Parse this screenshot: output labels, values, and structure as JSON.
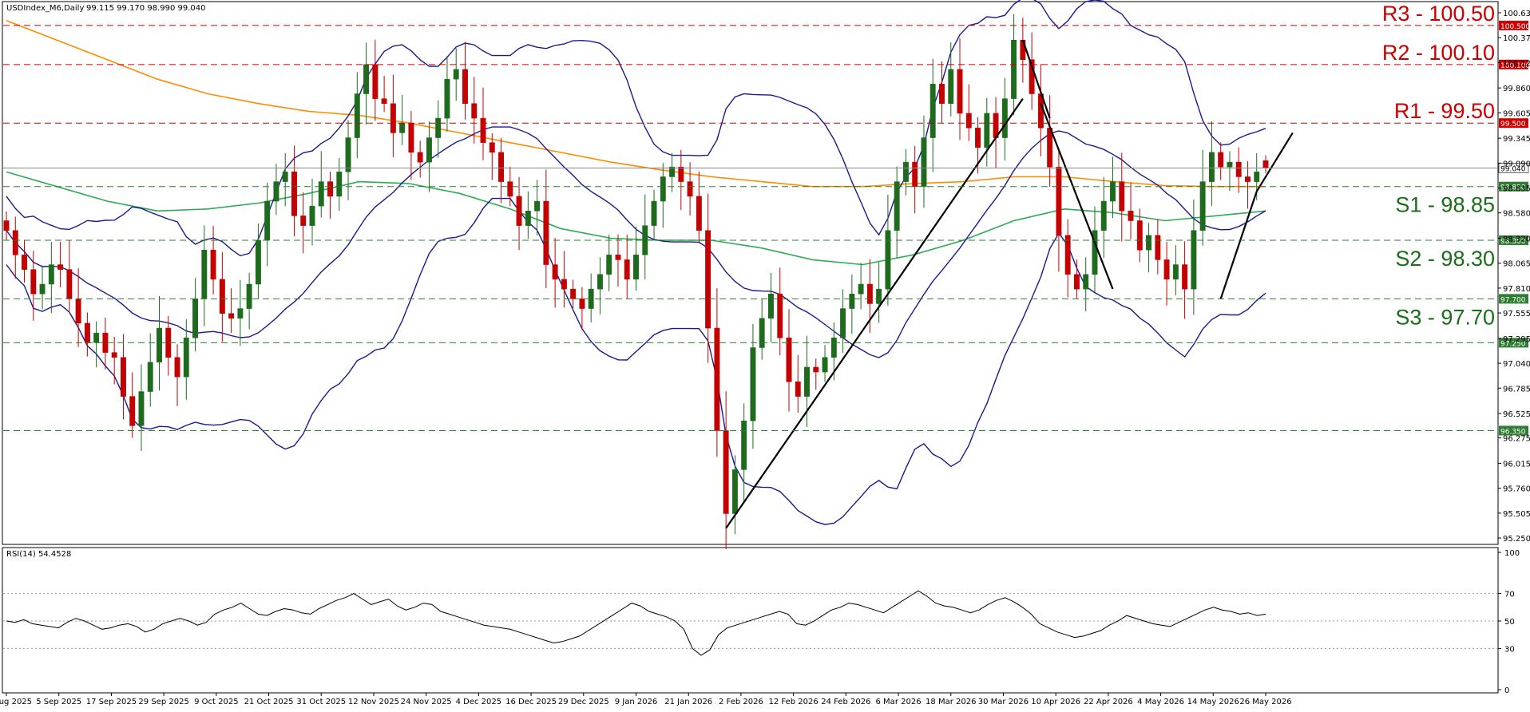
{
  "header": {
    "symbol": "USDIndex_M6,Daily",
    "ohlc": "99.115 99.170 98.990 99.040"
  },
  "rsi": {
    "label": "RSI(14) 54.4528",
    "ticks": [
      "100",
      "70",
      "50",
      "30",
      "0"
    ],
    "values": [
      50,
      49,
      51,
      48,
      47,
      46,
      45,
      49,
      52,
      50,
      47,
      44,
      45,
      47,
      48,
      46,
      42,
      44,
      48,
      50,
      52,
      50,
      47,
      49,
      55,
      58,
      60,
      63,
      59,
      55,
      54,
      57,
      59,
      58,
      56,
      55,
      59,
      62,
      65,
      67,
      70,
      66,
      62,
      64,
      66,
      61,
      58,
      60,
      63,
      62,
      57,
      55,
      53,
      51,
      49,
      47,
      46,
      45,
      44,
      42,
      40,
      38,
      36,
      34,
      35,
      37,
      39,
      43,
      47,
      51,
      55,
      59,
      63,
      61,
      57,
      55,
      53,
      50,
      44,
      30,
      25,
      29,
      40,
      45,
      47,
      49,
      51,
      53,
      55,
      57,
      55,
      48,
      47,
      50,
      54,
      58,
      60,
      63,
      62,
      60,
      58,
      56,
      60,
      64,
      68,
      72,
      68,
      63,
      61,
      60,
      58,
      56,
      58,
      62,
      65,
      67,
      64,
      60,
      55,
      48,
      45,
      42,
      40,
      38,
      39,
      41,
      43,
      47,
      50,
      54,
      52,
      50,
      48,
      47,
      46,
      49,
      52,
      55,
      58,
      60,
      58,
      57,
      55,
      56,
      54,
      55
    ],
    "colors": {
      "line": "#000000",
      "levels": "#999999"
    }
  },
  "price_axis": {
    "ticks": [
      "100.630",
      "100.375",
      "100.120",
      "99.860",
      "99.605",
      "99.345",
      "99.090",
      "98.835",
      "98.580",
      "98.320",
      "98.065",
      "97.810",
      "97.555",
      "97.295",
      "97.040",
      "96.785",
      "96.525",
      "96.275",
      "96.015",
      "95.760",
      "95.505",
      "95.250"
    ]
  },
  "level_tags": [
    "100.500",
    "100.100",
    "99.500",
    "99.040",
    "98.850",
    "98.300",
    "97.700",
    "97.250",
    "96.350"
  ],
  "levels": [
    {
      "label": "R3 - 100.50",
      "color": "#cc0000"
    },
    {
      "label": "R2 - 100.10",
      "color": "#cc0000"
    },
    {
      "label": "R1 - 99.50",
      "color": "#cc0000"
    },
    {
      "label": "S1 - 98.85",
      "color": "#1a6e1a"
    },
    {
      "label": "S2 - 98.30",
      "color": "#1a6e1a"
    },
    {
      "label": "S3 - 97.70",
      "color": "#1a6e1a"
    }
  ],
  "time_axis": {
    "labels": [
      "26 Aug 2025",
      "5 Sep 2025",
      "17 Sep 2025",
      "29 Sep 2025",
      "9 Oct 2025",
      "21 Oct 2025",
      "31 Oct 2025",
      "12 Nov 2025",
      "24 Nov 2025",
      "4 Dec 2025",
      "16 Dec 2025",
      "29 Dec 2025",
      "9 Jan 2026",
      "21 Jan 2026",
      "2 Feb 2026",
      "12 Feb 2026",
      "24 Feb 2026",
      "6 Mar 2026",
      "18 Mar 2026",
      "30 Mar 2026",
      "10 Apr 2026",
      "22 Apr 2026",
      "4 May 2026",
      "14 May 2026",
      "26 May 2026"
    ]
  },
  "chart_data": {
    "type": "candlestick",
    "symbol": "USDIndex_M6",
    "timeframe": "Daily",
    "last_bar_ohlc": {
      "open": 99.115,
      "high": 99.17,
      "low": 98.99,
      "close": 99.04
    },
    "ylim": [
      95.25,
      100.63
    ],
    "close_series": [
      98.4,
      98.15,
      98.0,
      97.75,
      97.85,
      98.05,
      98.0,
      97.7,
      97.45,
      97.25,
      97.35,
      97.15,
      97.1,
      96.7,
      96.4,
      96.75,
      97.05,
      97.4,
      97.1,
      96.9,
      97.3,
      97.7,
      98.2,
      97.9,
      97.55,
      97.5,
      97.6,
      97.85,
      98.3,
      98.7,
      98.9,
      99.0,
      98.55,
      98.45,
      98.65,
      98.9,
      98.75,
      99.0,
      99.35,
      99.8,
      100.1,
      99.75,
      99.7,
      99.4,
      99.5,
      99.2,
      99.1,
      99.35,
      99.55,
      99.95,
      100.05,
      99.7,
      99.55,
      99.3,
      99.2,
      98.9,
      98.75,
      98.45,
      98.6,
      98.7,
      98.05,
      97.9,
      97.8,
      97.7,
      97.6,
      97.8,
      97.95,
      98.15,
      98.1,
      97.9,
      98.15,
      98.45,
      98.7,
      98.95,
      99.05,
      98.9,
      98.75,
      98.4,
      97.4,
      96.35,
      95.5,
      95.95,
      96.45,
      97.2,
      97.5,
      97.75,
      97.3,
      96.85,
      96.7,
      97.0,
      96.95,
      97.1,
      97.3,
      97.6,
      97.75,
      97.85,
      97.65,
      97.8,
      98.4,
      98.9,
      99.1,
      98.85,
      99.35,
      99.9,
      99.7,
      100.05,
      99.6,
      99.45,
      99.25,
      99.6,
      99.35,
      99.75,
      100.35,
      100.15,
      99.8,
      99.45,
      99.05,
      98.35,
      97.95,
      97.8,
      97.95,
      98.4,
      98.7,
      98.9,
      98.6,
      98.5,
      98.2,
      98.35,
      98.1,
      97.9,
      98.05,
      97.8,
      98.4,
      98.9,
      99.2,
      99.05,
      99.1,
      98.95,
      98.9,
      99.0,
      99.04
    ],
    "indicators": [
      {
        "name": "MA (slow)",
        "color": "#ff8c00",
        "values": [
          100.55,
          100.35,
          100.15,
          99.95,
          99.8,
          99.7,
          99.62,
          99.58,
          99.5,
          99.4,
          99.3,
          99.2,
          99.1,
          99.02,
          98.95,
          98.9,
          98.85,
          98.85,
          98.88,
          98.9,
          98.95,
          98.95,
          98.9,
          98.86,
          98.85,
          98.85
        ]
      },
      {
        "name": "MA (mid)",
        "color": "#2eaa55",
        "values": [
          99.0,
          98.85,
          98.7,
          98.6,
          98.62,
          98.68,
          98.78,
          98.9,
          98.88,
          98.78,
          98.62,
          98.42,
          98.32,
          98.3,
          98.3,
          98.22,
          98.1,
          98.05,
          98.15,
          98.3,
          98.5,
          98.62,
          98.58,
          98.5,
          98.55,
          98.6
        ]
      },
      {
        "name": "Bollinger bands",
        "color": "#1a1a8c"
      }
    ],
    "horizontal_levels": [
      100.5,
      100.1,
      99.5,
      99.04,
      98.85,
      98.3,
      97.7,
      97.25,
      96.35
    ],
    "rsi_period": 14,
    "rsi_last": 54.4528
  }
}
